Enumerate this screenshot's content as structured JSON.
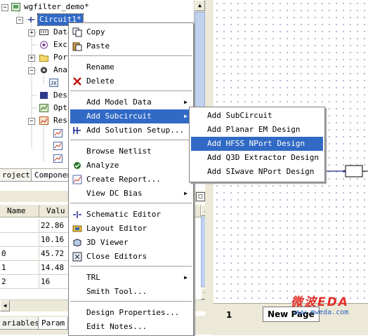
{
  "tree": {
    "root": "wgfilter_demo*",
    "circuit": "Circuit1*",
    "items": [
      "Data",
      "Exci",
      "Port",
      "Anal",
      "",
      "Desi",
      "Opti",
      "Resu"
    ]
  },
  "tabs_top": [
    "roject",
    "Componen"
  ],
  "table": {
    "headers": [
      "Name",
      "Valu"
    ],
    "rows": [
      {
        "a": "",
        "v": "22.86"
      },
      {
        "a": "",
        "v": "10.16"
      },
      {
        "a": "0",
        "v": "45.72"
      },
      {
        "a": "1",
        "v": "14.48"
      },
      {
        "a": "2",
        "v": "16"
      }
    ]
  },
  "tabs_bottom": [
    "ariables",
    "Param"
  ],
  "schematic": {
    "page_num": "1",
    "page_tab": "New Page",
    "watermark_cn": "微波EDA",
    "watermark_url": "www.mweda.com"
  },
  "menu": {
    "copy": "Copy",
    "paste": "Paste",
    "rename": "Rename",
    "delete": "Delete",
    "add_model_data": "Add Model Data",
    "add_subcircuit": "Add Subcircuit",
    "add_solution_setup": "Add Solution Setup...",
    "browse_netlist": "Browse Netlist",
    "analyze": "Analyze",
    "create_report": "Create Report...",
    "view_dc_bias": "View DC Bias",
    "schematic_editor": "Schematic Editor",
    "layout_editor": "Layout Editor",
    "viewer_3d": "3D Viewer",
    "close_editors": "Close Editors",
    "trl": "TRL",
    "smith_tool": "Smith Tool...",
    "design_properties": "Design Properties...",
    "edit_notes": "Edit Notes..."
  },
  "submenu": {
    "items": [
      "Add SubCircuit",
      "Add Planar EM Design",
      "Add HFSS NPort Design",
      "Add Q3D Extractor Design",
      "Add SIwave NPort Design"
    ],
    "selected": "Add HFSS NPort Design"
  },
  "colors": {
    "highlight": "#316ac5",
    "watermark": "#e0302a",
    "url": "#2b5fc0"
  }
}
